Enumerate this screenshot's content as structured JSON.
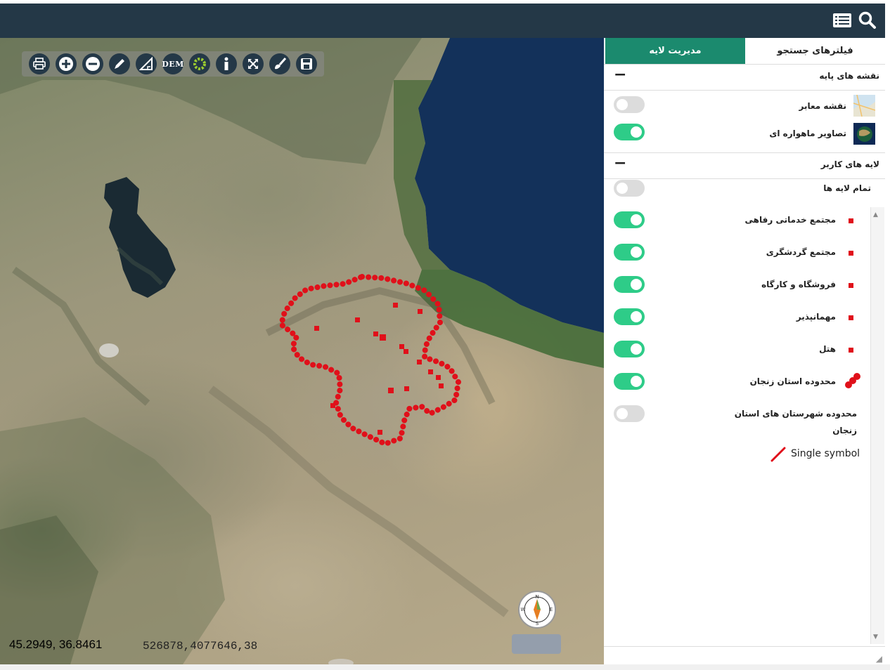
{
  "header": {
    "search_icon": "search-icon",
    "list_icon": "list-icon"
  },
  "toolbar": {
    "buttons": [
      "print-icon",
      "zoom-in-icon",
      "zoom-out-icon",
      "draw-line-icon",
      "measure-area-icon",
      "dem-button",
      "layer-toggle-icon",
      "info-icon",
      "full-extent-icon",
      "clear-icon",
      "save-icon"
    ],
    "dem_label": "DEM"
  },
  "map": {
    "coord_geo": "45.2949, 36.8461",
    "coord_utm": "526878,4077646,38",
    "compass": {
      "n": "N",
      "s": "S",
      "e": "E",
      "w": "W"
    },
    "boundary_color": "#e0101a"
  },
  "panel": {
    "tabs": {
      "active": "مدیریت لایه",
      "inactive": "فیلترهای جستجو"
    },
    "base_maps": {
      "title": "نقشه های پایه",
      "collapse": "−",
      "items": [
        {
          "label": "نقشه معابر",
          "on": false
        },
        {
          "label": "تصاویر ماهواره ای",
          "on": true
        }
      ]
    },
    "user_layers": {
      "title": "لایه های کاربر",
      "collapse": "−",
      "all_label": "تمام لایه ها",
      "all_on": false,
      "items": [
        {
          "label": "مجتمع خدماتی رفاهی",
          "on": true,
          "symbol": "red-square"
        },
        {
          "label": "مجتمع گردشگری",
          "on": true,
          "symbol": "red-square"
        },
        {
          "label": "فروشگاه و کارگاه",
          "on": true,
          "symbol": "red-square"
        },
        {
          "label": "مهمانپذیر",
          "on": true,
          "symbol": "red-square"
        },
        {
          "label": "هتل",
          "on": true,
          "symbol": "red-square"
        },
        {
          "label": "محدوده استان زنجان",
          "on": true,
          "symbol": "red-dots"
        },
        {
          "label_line1": "محدوده شهرستان های استان",
          "label_line2": "زنجان",
          "on": false,
          "symbol": "red-line"
        }
      ],
      "single_symbol": "Single symbol"
    }
  },
  "colors": {
    "header": "#243847",
    "tab_active": "#1b8a6e",
    "toggle_on": "#2ecc88",
    "toggle_off": "#dcdcdc",
    "point": "#e0101a"
  }
}
